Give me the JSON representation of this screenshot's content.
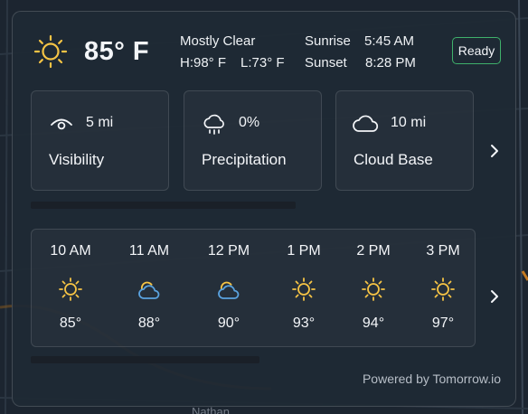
{
  "map": {
    "street_label": "Nathan"
  },
  "current": {
    "icon": "sun-icon",
    "temperature": "85° F",
    "condition": "Mostly Clear",
    "high": "H:98° F",
    "low": "L:73° F",
    "sunrise_label": "Sunrise",
    "sunrise_time": "5:45 AM",
    "sunset_label": "Sunset",
    "sunset_time": "8:28 PM"
  },
  "status": {
    "label": "Ready",
    "color": "#3fb06b"
  },
  "stats": [
    {
      "icon": "eye-icon",
      "value": "5 mi",
      "name": "Visibility"
    },
    {
      "icon": "rain-cloud-icon",
      "value": "0%",
      "name": "Precipitation"
    },
    {
      "icon": "cloud-icon",
      "value": "10 mi",
      "name": "Cloud Base"
    }
  ],
  "hourly": [
    {
      "time": "10 AM",
      "icon": "sun-icon",
      "temp": "85°"
    },
    {
      "time": "11 AM",
      "icon": "partly-cloudy-icon",
      "temp": "88°"
    },
    {
      "time": "12 PM",
      "icon": "partly-cloudy-icon",
      "temp": "90°"
    },
    {
      "time": "1 PM",
      "icon": "sun-icon",
      "temp": "93°"
    },
    {
      "time": "2 PM",
      "icon": "sun-icon",
      "temp": "94°"
    },
    {
      "time": "3 PM",
      "icon": "sun-icon",
      "temp": "97°"
    }
  ],
  "footer": {
    "powered_by": "Powered by Tomorrow.io"
  },
  "colors": {
    "sun": "#f6c445",
    "cloud": "#5aa3e0",
    "text": "#f3f5f8"
  }
}
